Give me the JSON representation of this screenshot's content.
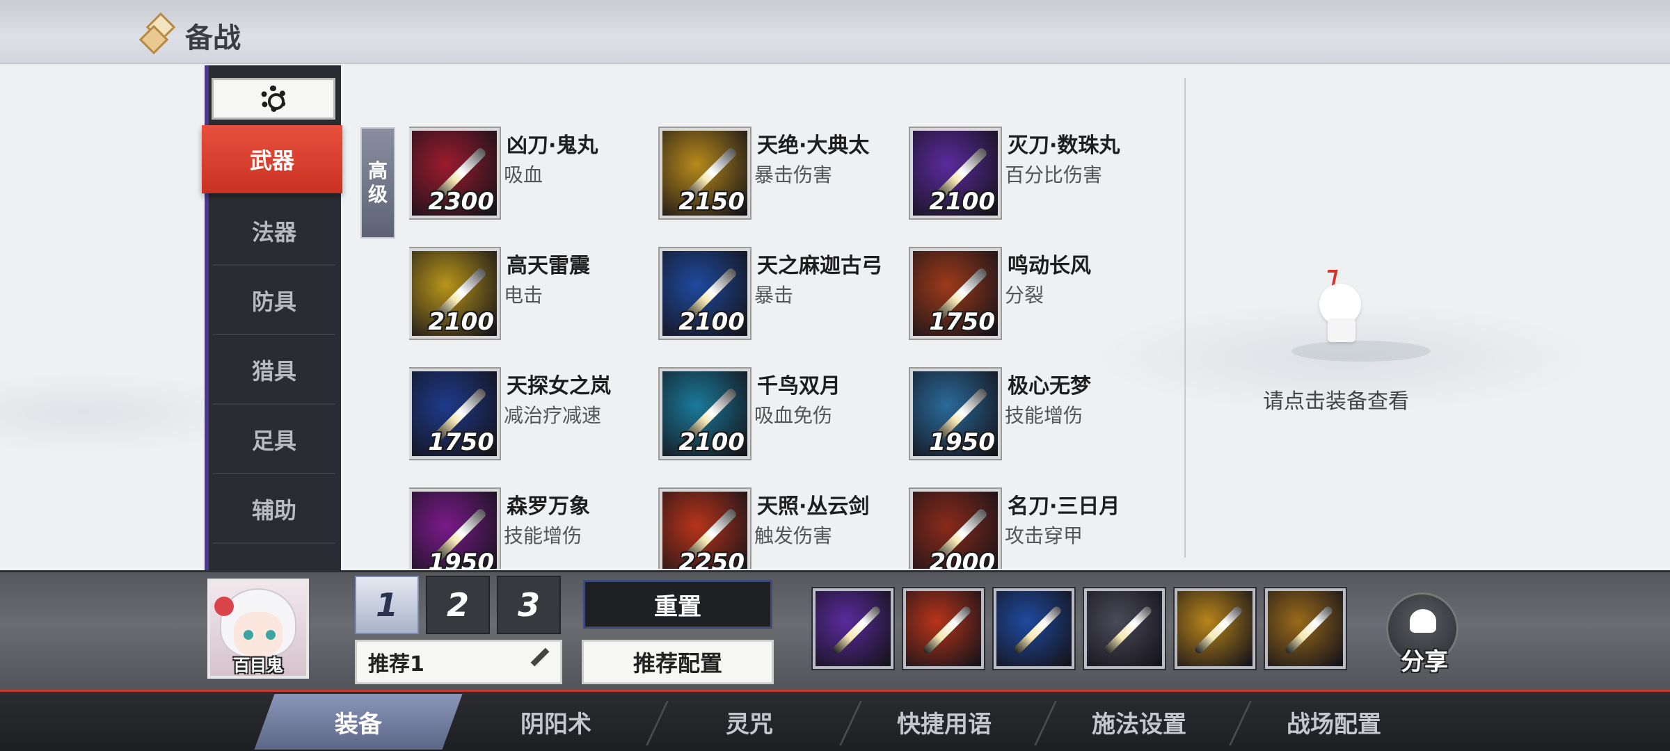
{
  "header": {
    "title": "备战"
  },
  "categories": [
    {
      "label": "武器",
      "active": true
    },
    {
      "label": "法器",
      "active": false
    },
    {
      "label": "防具",
      "active": false
    },
    {
      "label": "猎具",
      "active": false
    },
    {
      "label": "足具",
      "active": false
    },
    {
      "label": "辅助",
      "active": false
    }
  ],
  "grade_label": [
    "高",
    "级"
  ],
  "items": [
    {
      "name": "凶刀·鬼丸",
      "desc": "吸血",
      "cost": "2300",
      "icon": "katana-icon",
      "color": "#9c1b2e"
    },
    {
      "name": "天绝·大典太",
      "desc": "暴击伤害",
      "cost": "2150",
      "icon": "katana-icon",
      "color": "#b88a1a"
    },
    {
      "name": "灭刀·数珠丸",
      "desc": "百分比伤害",
      "cost": "2100",
      "icon": "katana-icon",
      "color": "#5b2a9e"
    },
    {
      "name": "高天雷震",
      "desc": "电击",
      "cost": "2100",
      "icon": "hammer-icon",
      "color": "#b8951a"
    },
    {
      "name": "天之麻迦古弓",
      "desc": "暴击",
      "cost": "2100",
      "icon": "bow-icon",
      "color": "#1e4a9e"
    },
    {
      "name": "鸣动长风",
      "desc": "分裂",
      "cost": "1750",
      "icon": "bow-icon",
      "color": "#9e3a1a"
    },
    {
      "name": "天探女之岚",
      "desc": "减治疗减速",
      "cost": "1750",
      "icon": "crossbow-icon",
      "color": "#1e3a8a"
    },
    {
      "name": "千鸟双月",
      "desc": "吸血免伤",
      "cost": "2100",
      "icon": "twin-blade-icon",
      "color": "#1a7a9a"
    },
    {
      "name": "极心无梦",
      "desc": "技能增伤",
      "cost": "1950",
      "icon": "chain-sickle-icon",
      "color": "#2a6a9a"
    },
    {
      "name": "森罗万象",
      "desc": "技能增伤",
      "cost": "1950",
      "icon": "axe-icon",
      "color": "#7a1a8a"
    },
    {
      "name": "天照·丛云剑",
      "desc": "触发伤害",
      "cost": "2250",
      "icon": "sword-icon",
      "color": "#b8341a"
    },
    {
      "name": "名刀·三日月",
      "desc": "攻击穿甲",
      "cost": "2000",
      "icon": "katana-icon",
      "color": "#8a2a1a"
    }
  ],
  "right_panel": {
    "hint": "请点击装备查看"
  },
  "loadout": {
    "character_name": "百目鬼",
    "slots": [
      "1",
      "2",
      "3"
    ],
    "active_slot": "1",
    "preset_name": "推荐1",
    "reset_label": "重置",
    "recommend_label": "推荐配置",
    "equipped": [
      {
        "icon": "katana-icon",
        "color": "#5b2a9e"
      },
      {
        "icon": "bow-icon",
        "color": "#b8341a"
      },
      {
        "icon": "katana-icon",
        "color": "#1e4a9e"
      },
      {
        "icon": "bow-icon",
        "color": "#4a4a5a"
      },
      {
        "icon": "crossbow-icon",
        "color": "#b8851a"
      },
      {
        "icon": "staff-icon",
        "color": "#9a6a1a"
      }
    ],
    "share_label": "分享"
  },
  "tabs": [
    {
      "label": "装备",
      "active": true
    },
    {
      "label": "阴阳术",
      "active": false
    },
    {
      "label": "灵咒",
      "active": false
    },
    {
      "label": "快捷用语",
      "active": false
    },
    {
      "label": "施法设置",
      "active": false
    },
    {
      "label": "战场配置",
      "active": false
    }
  ]
}
